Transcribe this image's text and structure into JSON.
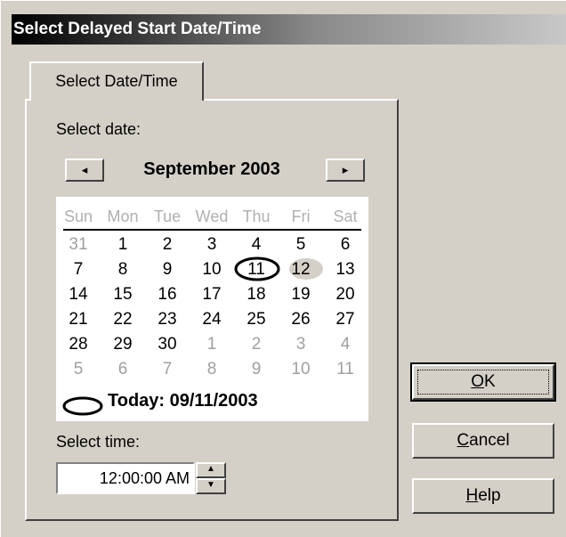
{
  "title": "Select Delayed Start Date/Time",
  "tab_label": "Select Date/Time",
  "select_date_label": "Select date:",
  "calendar": {
    "month_year": "September 2003",
    "prev_glyph": "◂",
    "next_glyph": "▸",
    "weekdays": [
      "Sun",
      "Mon",
      "Tue",
      "Wed",
      "Thu",
      "Fri",
      "Sat"
    ],
    "weeks": [
      [
        "31",
        "1",
        "2",
        "3",
        "4",
        "5",
        "6"
      ],
      [
        "7",
        "8",
        "9",
        "10",
        "11",
        "12",
        "13"
      ],
      [
        "14",
        "15",
        "16",
        "17",
        "18",
        "19",
        "20"
      ],
      [
        "21",
        "22",
        "23",
        "24",
        "25",
        "26",
        "27"
      ],
      [
        "28",
        "29",
        "30",
        "1",
        "2",
        "3",
        "4"
      ],
      [
        "5",
        "6",
        "7",
        "8",
        "9",
        "10",
        "11"
      ]
    ],
    "today_text": "Today: 09/11/2003",
    "today_day": "11",
    "selected_day": "12"
  },
  "select_time_label": "Select time:",
  "time_value": "12:00:00 AM",
  "buttons": {
    "ok_prefix": "",
    "ok_accel": "O",
    "ok_suffix": "K",
    "cancel_accel": "C",
    "cancel_suffix": "ancel",
    "help_accel": "H",
    "help_suffix": "elp"
  }
}
